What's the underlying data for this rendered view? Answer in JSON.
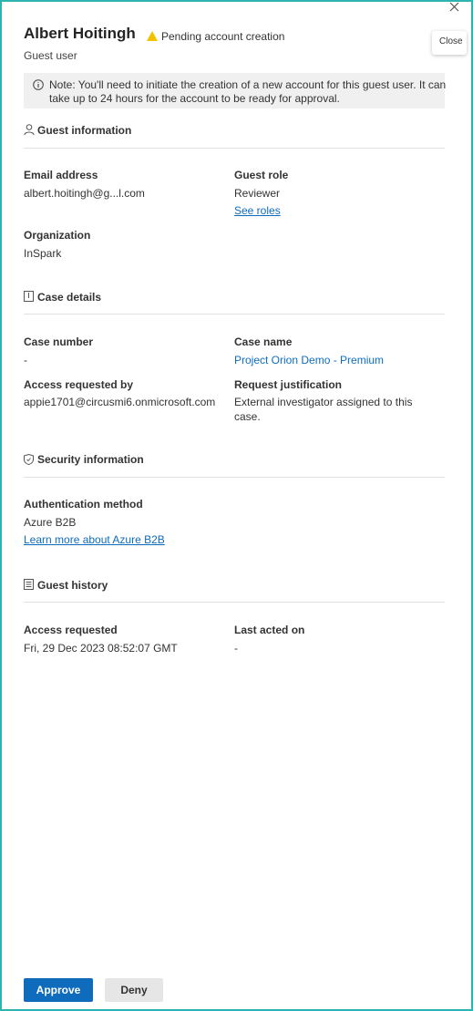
{
  "header": {
    "name": "Albert Hoitingh",
    "status": "Pending account creation",
    "subtitle": "Guest user",
    "close_tooltip": "Close"
  },
  "note": {
    "text_line1": "Note: You'll need to initiate the creation of a new account for this guest user. It can",
    "text_line2": "take up to 24 hours for the account to be ready for approval."
  },
  "guest_information": {
    "title": "Guest information",
    "email_label": "Email address",
    "email_value": "albert.hoitingh@g...l.com",
    "role_label": "Guest role",
    "role_value": "Reviewer",
    "see_roles": "See roles",
    "org_label": "Organization",
    "org_value": "InSpark"
  },
  "case_details": {
    "title": "Case details",
    "case_number_label": "Case number",
    "case_number_value": "-",
    "case_name_label": "Case name",
    "case_name_value": "Project Orion Demo - Premium",
    "access_by_label": "Access requested by",
    "access_by_value": "appie1701@circusmi6.onmicrosoft.com",
    "justification_label": "Request justification",
    "justification_line1": "External investigator assigned to this",
    "justification_line2": "case."
  },
  "security_information": {
    "title": "Security information",
    "auth_label": "Authentication method",
    "auth_value": "Azure B2B",
    "learn_more": "Learn more about Azure B2B"
  },
  "guest_history": {
    "title": "Guest history",
    "requested_label": "Access requested",
    "requested_value": "Fri, 29 Dec 2023 08:52:07 GMT",
    "last_acted_label": "Last acted on",
    "last_acted_value": "-"
  },
  "footer": {
    "approve": "Approve",
    "deny": "Deny"
  },
  "colors": {
    "accent": "#0f6cbd",
    "warning": "#f2c200",
    "frame": "#2fb3b0"
  }
}
